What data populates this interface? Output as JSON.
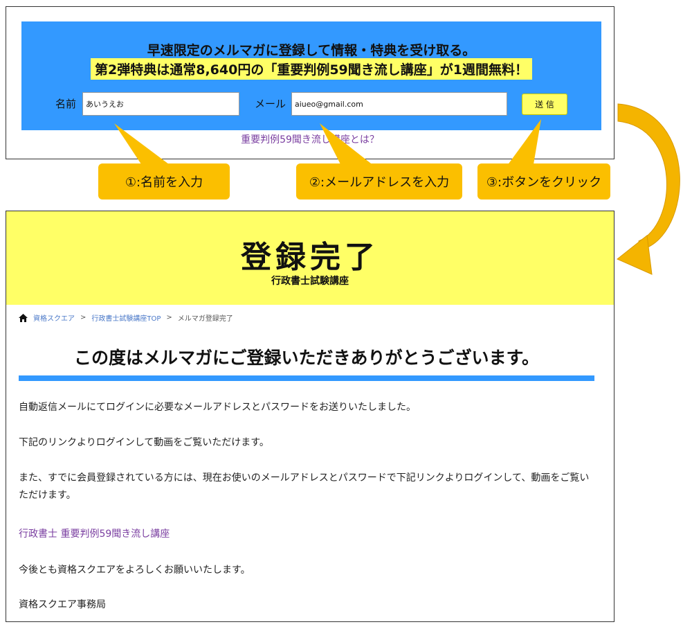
{
  "signup": {
    "headline": "早速限定のメルマガに登録して情報・特典を受け取る。",
    "sub_headline": "第2弾特典は通常8,640円の「重要判例59聞き流し講座」が1週間無料！",
    "name_label": "名前",
    "name_value": "あいうえお",
    "mail_label": "メール",
    "mail_value": "aiueo@gmail.com",
    "submit_label": "送 信",
    "about_link": "重要判例59聞き流し講座とは？"
  },
  "callouts": {
    "step1": "①:名前を入力",
    "step2": "②:メールアドレスを入力",
    "step3": "③:ボタンをクリック"
  },
  "completion": {
    "hero_title": "登録完了",
    "hero_sub": "行政書士試験講座",
    "breadcrumb": {
      "home": "資格スクエア",
      "separator": ">",
      "section": "行政書士試験講座TOP",
      "current": "メルマガ登録完了"
    },
    "page_title": "この度はメルマガにご登録いただきありがとうございます。",
    "paragraphs": {
      "p1": "自動返信メールにてログインに必要なメールアドレスとパスワードをお送りいたしました。",
      "p2": "下記のリンクよりログインして動画をご覧いただけます。",
      "p3": "また、すでに会員登録されている方には、現在お使いのメールアドレスとパスワードで下記リンクよりログインして、動画をご覧いただけます。",
      "course_link": "行政書士 重要判例59聞き流し講座",
      "p5": "今後とも資格スクエアをよろしくお願いいたします。",
      "p6": "資格スクエア事務局"
    }
  },
  "colors": {
    "form_blue": "#3399ff",
    "highlight_yellow": "#ffff66",
    "callout_orange": "#fbbf00",
    "link_purple": "#7a3ea0",
    "breadcrumb_blue": "#4a78c8"
  },
  "icons": {
    "home": "home-icon",
    "flow_arrow": "curved-arrow-icon"
  }
}
